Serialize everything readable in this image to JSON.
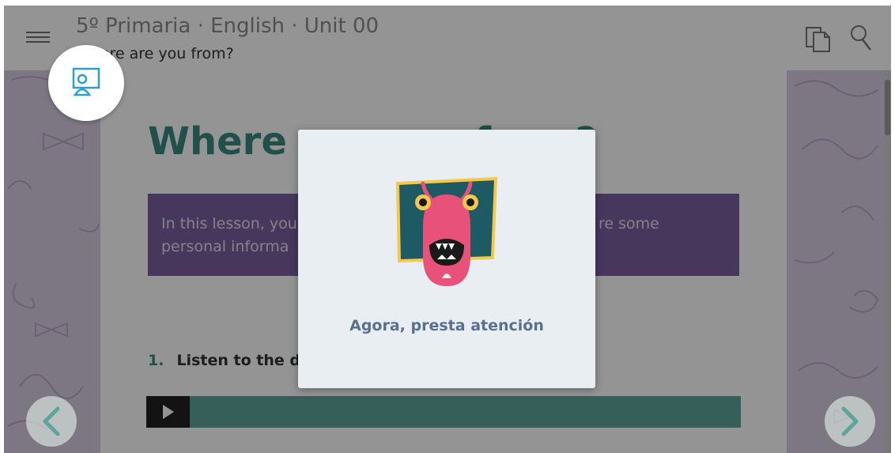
{
  "header": {
    "title": "5º Primaria · English · Unit 00",
    "subtitle": "Where are you from?",
    "icons": [
      "menu-icon",
      "pages-icon",
      "search-icon"
    ]
  },
  "lesson": {
    "title": "Where are you from?",
    "intro_line1": "In this lesson, you",
    "intro_line2": "personal informa",
    "intro_line1_end": "re some",
    "exercise_number": "1.",
    "exercise_text": "Listen to the di"
  },
  "modal": {
    "message": "Agora, presta atención",
    "illustration": "monster-board-illustration"
  },
  "colors": {
    "teal": "#3a8a82",
    "purple": "#7a5fa0",
    "modal_bg": "#e9eef3",
    "modal_text": "#5b6f8e",
    "badge_icon": "#2a9fd6"
  }
}
